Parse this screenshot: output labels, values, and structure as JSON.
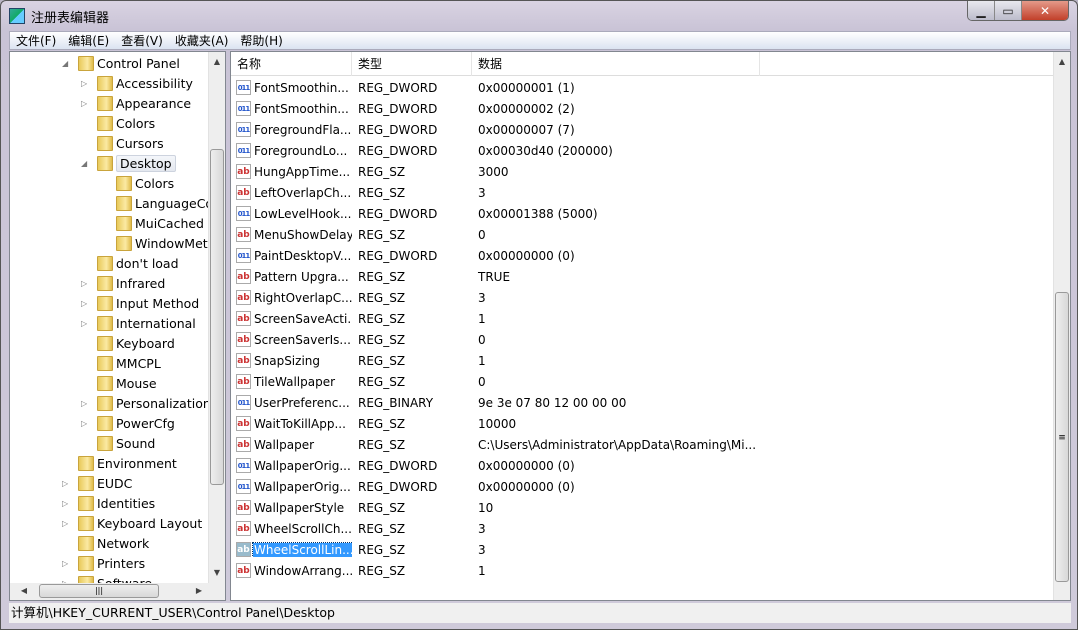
{
  "window": {
    "title": "注册表编辑器",
    "controls": [
      "minimize",
      "maximize",
      "close"
    ]
  },
  "menu": [
    "文件(F)",
    "编辑(E)",
    "查看(V)",
    "收藏夹(A)",
    "帮助(H)"
  ],
  "tree": [
    {
      "label": "Control Panel",
      "level": 0,
      "exp": "open"
    },
    {
      "label": "Accessibility",
      "level": 1,
      "exp": "closed"
    },
    {
      "label": "Appearance",
      "level": 1,
      "exp": "closed"
    },
    {
      "label": "Colors",
      "level": 1,
      "exp": ""
    },
    {
      "label": "Cursors",
      "level": 1,
      "exp": ""
    },
    {
      "label": "Desktop",
      "level": 1,
      "exp": "open",
      "selected": true
    },
    {
      "label": "Colors",
      "level": 2,
      "exp": ""
    },
    {
      "label": "LanguageConfiguration",
      "level": 2,
      "exp": ""
    },
    {
      "label": "MuiCached",
      "level": 2,
      "exp": ""
    },
    {
      "label": "WindowMetrics",
      "level": 2,
      "exp": ""
    },
    {
      "label": "don't load",
      "level": 1,
      "exp": ""
    },
    {
      "label": "Infrared",
      "level": 1,
      "exp": "closed"
    },
    {
      "label": "Input Method",
      "level": 1,
      "exp": "closed"
    },
    {
      "label": "International",
      "level": 1,
      "exp": "closed"
    },
    {
      "label": "Keyboard",
      "level": 1,
      "exp": ""
    },
    {
      "label": "MMCPL",
      "level": 1,
      "exp": ""
    },
    {
      "label": "Mouse",
      "level": 1,
      "exp": ""
    },
    {
      "label": "Personalization",
      "level": 1,
      "exp": "closed"
    },
    {
      "label": "PowerCfg",
      "level": 1,
      "exp": "closed"
    },
    {
      "label": "Sound",
      "level": 1,
      "exp": ""
    },
    {
      "label": "Environment",
      "level": 0,
      "exp": ""
    },
    {
      "label": "EUDC",
      "level": 0,
      "exp": "closed"
    },
    {
      "label": "Identities",
      "level": 0,
      "exp": "closed"
    },
    {
      "label": "Keyboard Layout",
      "level": 0,
      "exp": "closed"
    },
    {
      "label": "Network",
      "level": 0,
      "exp": ""
    },
    {
      "label": "Printers",
      "level": 0,
      "exp": "closed"
    },
    {
      "label": "Software",
      "level": 0,
      "exp": "closed"
    }
  ],
  "list": {
    "headers": [
      "名称",
      "类型",
      "数据"
    ],
    "rows": [
      {
        "name": "FontSmoothin...",
        "type": "REG_DWORD",
        "data": "0x00000001 (1)"
      },
      {
        "name": "FontSmoothin...",
        "type": "REG_DWORD",
        "data": "0x00000002 (2)"
      },
      {
        "name": "ForegroundFla...",
        "type": "REG_DWORD",
        "data": "0x00000007 (7)"
      },
      {
        "name": "ForegroundLo...",
        "type": "REG_DWORD",
        "data": "0x00030d40 (200000)"
      },
      {
        "name": "HungAppTime...",
        "type": "REG_SZ",
        "data": "3000"
      },
      {
        "name": "LeftOverlapCh...",
        "type": "REG_SZ",
        "data": "3"
      },
      {
        "name": "LowLevelHook...",
        "type": "REG_DWORD",
        "data": "0x00001388 (5000)"
      },
      {
        "name": "MenuShowDelay",
        "type": "REG_SZ",
        "data": "0"
      },
      {
        "name": "PaintDesktopV...",
        "type": "REG_DWORD",
        "data": "0x00000000 (0)"
      },
      {
        "name": "Pattern Upgra...",
        "type": "REG_SZ",
        "data": "TRUE"
      },
      {
        "name": "RightOverlapC...",
        "type": "REG_SZ",
        "data": "3"
      },
      {
        "name": "ScreenSaveActi...",
        "type": "REG_SZ",
        "data": "1"
      },
      {
        "name": "ScreenSaverIs...",
        "type": "REG_SZ",
        "data": "0"
      },
      {
        "name": "SnapSizing",
        "type": "REG_SZ",
        "data": "1"
      },
      {
        "name": "TileWallpaper",
        "type": "REG_SZ",
        "data": "0"
      },
      {
        "name": "UserPreferenc...",
        "type": "REG_BINARY",
        "data": "9e 3e 07 80 12 00 00 00"
      },
      {
        "name": "WaitToKillApp...",
        "type": "REG_SZ",
        "data": "10000"
      },
      {
        "name": "Wallpaper",
        "type": "REG_SZ",
        "data": "C:\\Users\\Administrator\\AppData\\Roaming\\Mi..."
      },
      {
        "name": "WallpaperOrig...",
        "type": "REG_DWORD",
        "data": "0x00000000 (0)"
      },
      {
        "name": "WallpaperOrig...",
        "type": "REG_DWORD",
        "data": "0x00000000 (0)"
      },
      {
        "name": "WallpaperStyle",
        "type": "REG_SZ",
        "data": "10"
      },
      {
        "name": "WheelScrollCh...",
        "type": "REG_SZ",
        "data": "3"
      },
      {
        "name": "WheelScrollLin...",
        "type": "REG_SZ",
        "data": "3",
        "selected": true
      },
      {
        "name": "WindowArrang...",
        "type": "REG_SZ",
        "data": "1"
      }
    ]
  },
  "status": "计算机\\HKEY_CURRENT_USER\\Control Panel\\Desktop",
  "colors": {
    "selection": "#3399ff",
    "string_icon": "#cc3333",
    "binary_icon": "#2255cc"
  }
}
